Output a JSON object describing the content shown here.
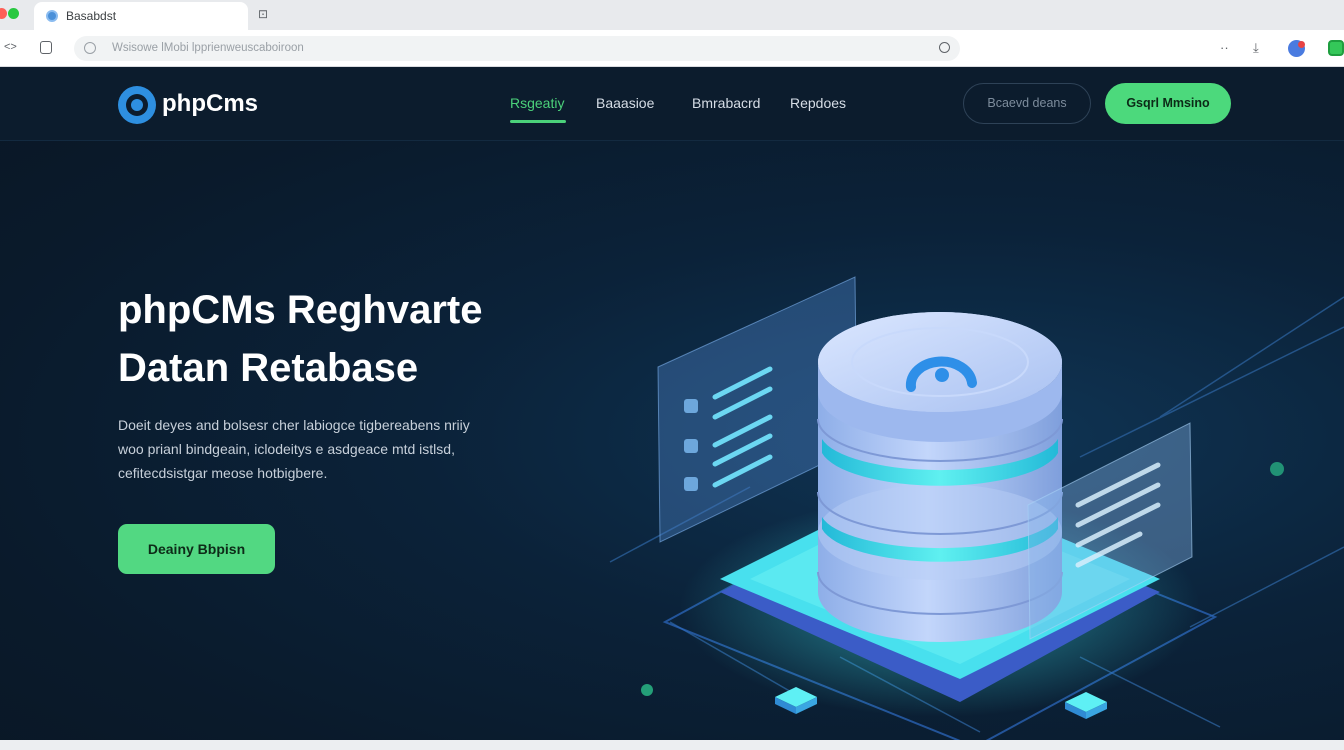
{
  "browser": {
    "tab_title": "Basabdst",
    "address_text": "Wsisowe lMobi lpprienweuscaboiroon",
    "nav_back": "<>"
  },
  "site": {
    "logo_text": "phpCms",
    "nav": [
      "Rsgeatiy",
      "Baaasioe",
      "Bmrabacrd",
      "Repdoes"
    ],
    "active_nav_index": 0,
    "outline_button": "Bcaevd deans",
    "primary_button": "Gsqrl Mmsino"
  },
  "hero": {
    "title_line1": "phpCMs Reghvarte",
    "title_line2": "Datan Retabase",
    "desc_line1": "Doeit deyes and bolsesr cher labiogce tigbereabens nriiy",
    "desc_line2": "woo prianl bindgeain, iclodeitys e asdgeace mtd istlsd,",
    "desc_line3": "cefitecdsistgar meose hotbigbere.",
    "cta": "Deainy Bbpisn"
  },
  "colors": {
    "accent_green": "#4cd97c",
    "bg_dark": "#0a1a2b",
    "cylinder": "#a9c4f5",
    "glow_cyan": "#3fe0e8"
  }
}
